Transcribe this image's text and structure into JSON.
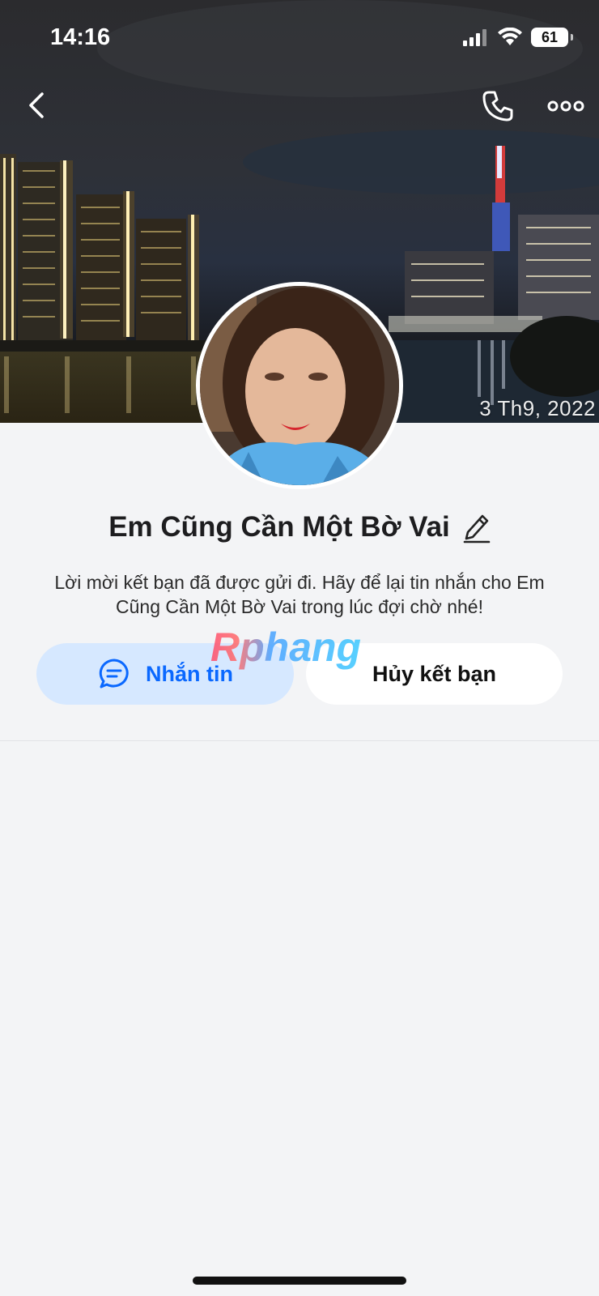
{
  "status_bar": {
    "time": "14:16",
    "battery": "61"
  },
  "cover": {
    "date_stamp": "3 Th9, 2022"
  },
  "nav": {
    "back_icon": "chevron-left-icon",
    "call_icon": "phone-icon",
    "more_icon": "more-dots-icon"
  },
  "profile": {
    "name": "Em Cũng Cần Một Bờ Vai",
    "notice": "Lời mời kết bạn đã được gửi đi. Hãy để lại tin nhắn cho Em Cũng Cần Một Bờ Vai trong lúc đợi chờ nhé!"
  },
  "actions": {
    "message_label": "Nhắn tin",
    "unfriend_label": "Hủy kết bạn"
  },
  "watermark": "Rphang",
  "colors": {
    "accent": "#0a68ff",
    "message_button_bg": "#d6e8ff",
    "page_bg": "#f3f4f6"
  }
}
